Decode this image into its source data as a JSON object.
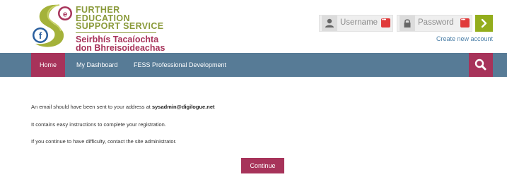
{
  "logo": {
    "line1": "FURTHER EDUCATION",
    "line2": "SUPPORT SERVICE",
    "line3": "Seirbhís Tacaíochta",
    "line4": "don Bhreisoideachas",
    "icon_letter_e": "e",
    "icon_letter_f": "f"
  },
  "login": {
    "username_placeholder": "Username",
    "password_placeholder": "Password",
    "create_account": "Create new account",
    "user_icon": "user-icon",
    "lock_icon": "lock-icon",
    "go_icon": "chevron-right-icon"
  },
  "nav": {
    "items": [
      {
        "label": "Home"
      },
      {
        "label": "My Dashboard"
      },
      {
        "label": "FESS Professional Development"
      }
    ],
    "search_icon": "search-icon"
  },
  "main": {
    "line1_prefix": "An email should have been sent to your address at",
    "line1_email": "sysadmin@digilogue.net",
    "line2": "It contains easy instructions to complete your registration.",
    "line3": "If you continue to have difficulty, contact the site administrator.",
    "continue_label": "Continue"
  },
  "colors": {
    "brand_primary": "#a7335a",
    "nav_bg": "#577b96",
    "brand_green": "#93ad1c",
    "link": "#4b7fa8"
  }
}
